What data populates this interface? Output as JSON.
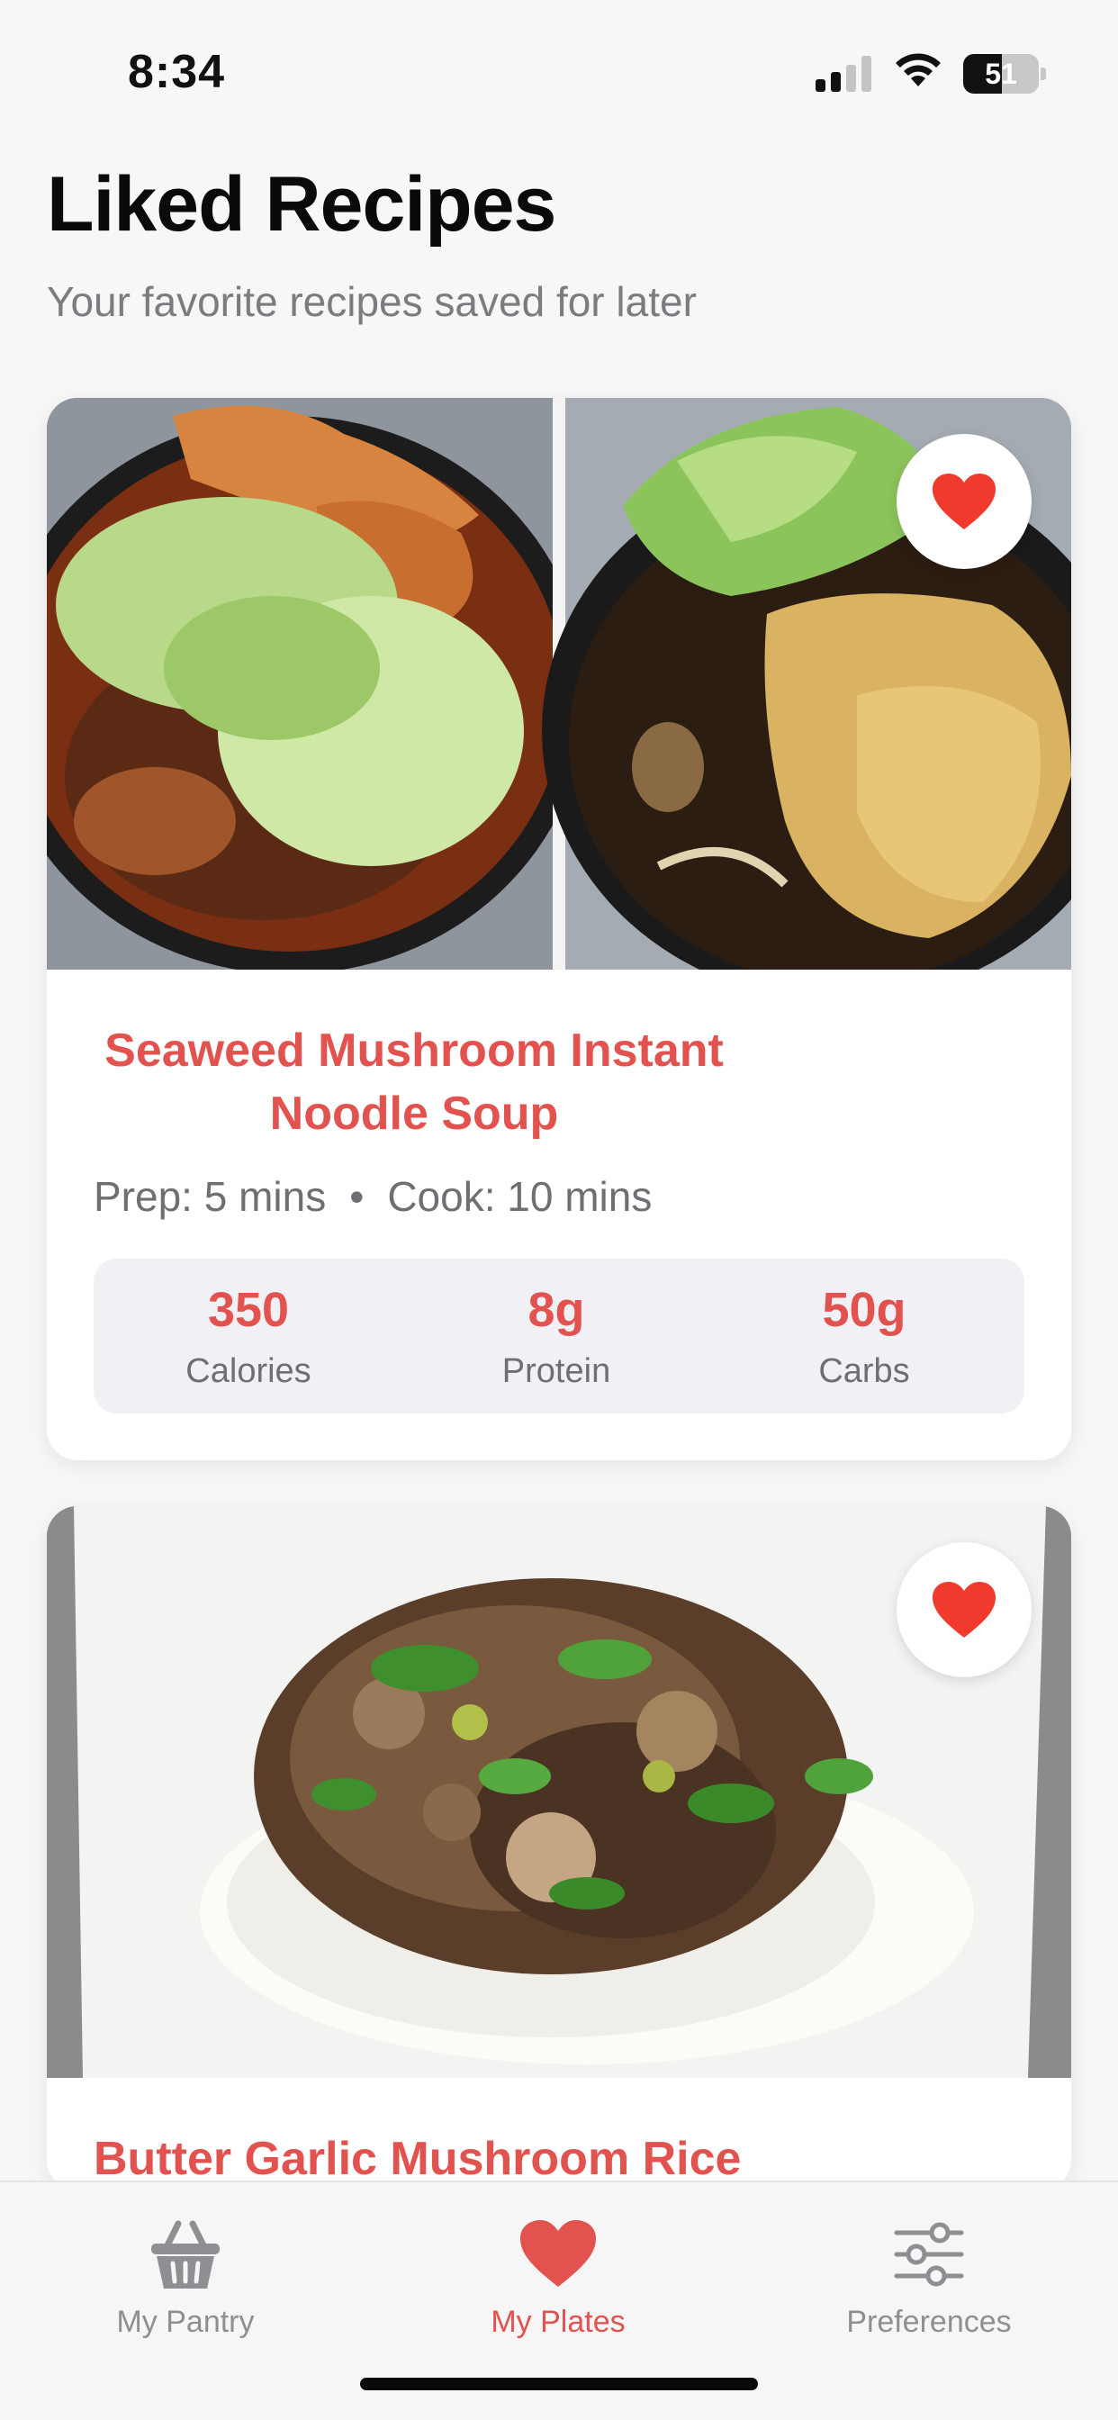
{
  "status_bar": {
    "time": "8:34",
    "battery": "51",
    "battery_level": 0.51
  },
  "header": {
    "title": "Liked Recipes",
    "subtitle": "Your favorite recipes saved for later"
  },
  "recipes": [
    {
      "title": "Seaweed Mushroom Instant Noodle Soup",
      "prep": "Prep: 5 mins",
      "separator": "•",
      "cook": "Cook: 10 mins",
      "liked": true,
      "nutrition": [
        {
          "value": "350",
          "label": "Calories"
        },
        {
          "value": "8g",
          "label": "Protein"
        },
        {
          "value": "50g",
          "label": "Carbs"
        }
      ]
    },
    {
      "title": "Butter Garlic Mushroom Rice",
      "liked": true
    }
  ],
  "tabs": [
    {
      "label": "My Pantry",
      "icon": "basket-icon",
      "active": false
    },
    {
      "label": "My Plates",
      "icon": "heart-icon",
      "active": true
    },
    {
      "label": "Preferences",
      "icon": "sliders-icon",
      "active": false
    }
  ],
  "colors": {
    "accent": "#e2524f",
    "like_heart": "#f03a2e",
    "muted_text": "#6e6e73",
    "tab_inactive": "#8e8e93"
  }
}
